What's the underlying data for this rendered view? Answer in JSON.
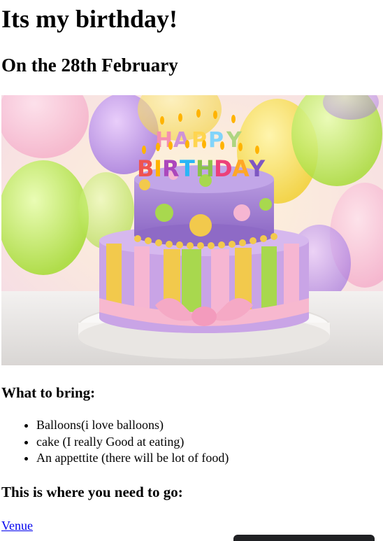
{
  "page": {
    "title": "Its my birthday!",
    "subtitle": "On the 28th February"
  },
  "hero_image": {
    "description_icon": "birthday-cake-image",
    "candle_text_top": "HAPPY",
    "candle_text_bottom": "BIRTHDAY"
  },
  "bring": {
    "heading": "What to bring:",
    "items": [
      "Balloons(i love balloons)",
      "cake (I really Good at eating)",
      "An appettite (there will be lot of food)"
    ]
  },
  "directions": {
    "heading": "This is where you need to go:",
    "link_label": "Venue"
  },
  "colors": {
    "link": "#0000ee",
    "bottom_bar": "#202124"
  }
}
